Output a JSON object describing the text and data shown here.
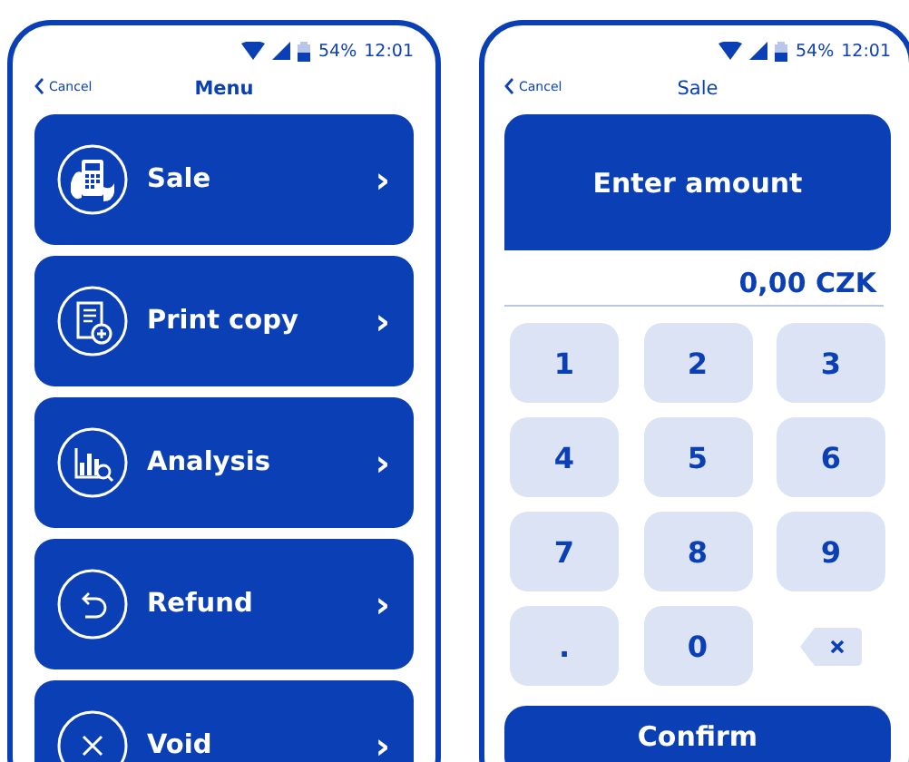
{
  "menu_screen": {
    "status_bar": {
      "battery": "54%",
      "time": "12:01"
    },
    "back": "Cancel",
    "title": "Menu",
    "items": [
      {
        "kind": "sale",
        "label": "Sale",
        "chevron": "›"
      },
      {
        "kind": "print",
        "label": "Print copy",
        "chevron": "›"
      },
      {
        "kind": "analysis",
        "label": "Analysis",
        "chevron": "›"
      },
      {
        "kind": "refund",
        "label": "Refund",
        "chevron": "›"
      },
      {
        "kind": "void",
        "label": "Void",
        "chevron": "›"
      }
    ]
  },
  "sale_screen": {
    "status_bar": {
      "battery": "54%",
      "time": "12:01"
    },
    "back": "Cancel",
    "title": "Sale",
    "prompt": "Enter amount",
    "amount": "0,00 CZK",
    "keys": [
      {
        "kind": "digit",
        "label": "1"
      },
      {
        "kind": "digit",
        "label": "2"
      },
      {
        "kind": "digit",
        "label": "3"
      },
      {
        "kind": "digit",
        "label": "4"
      },
      {
        "kind": "digit",
        "label": "5"
      },
      {
        "kind": "digit",
        "label": "6"
      },
      {
        "kind": "digit",
        "label": "7"
      },
      {
        "kind": "digit",
        "label": "8"
      },
      {
        "kind": "digit",
        "label": "9"
      },
      {
        "kind": "digit",
        "label": "."
      },
      {
        "kind": "digit",
        "label": "0"
      },
      {
        "kind": "backspace"
      }
    ],
    "confirm": "Confirm"
  }
}
